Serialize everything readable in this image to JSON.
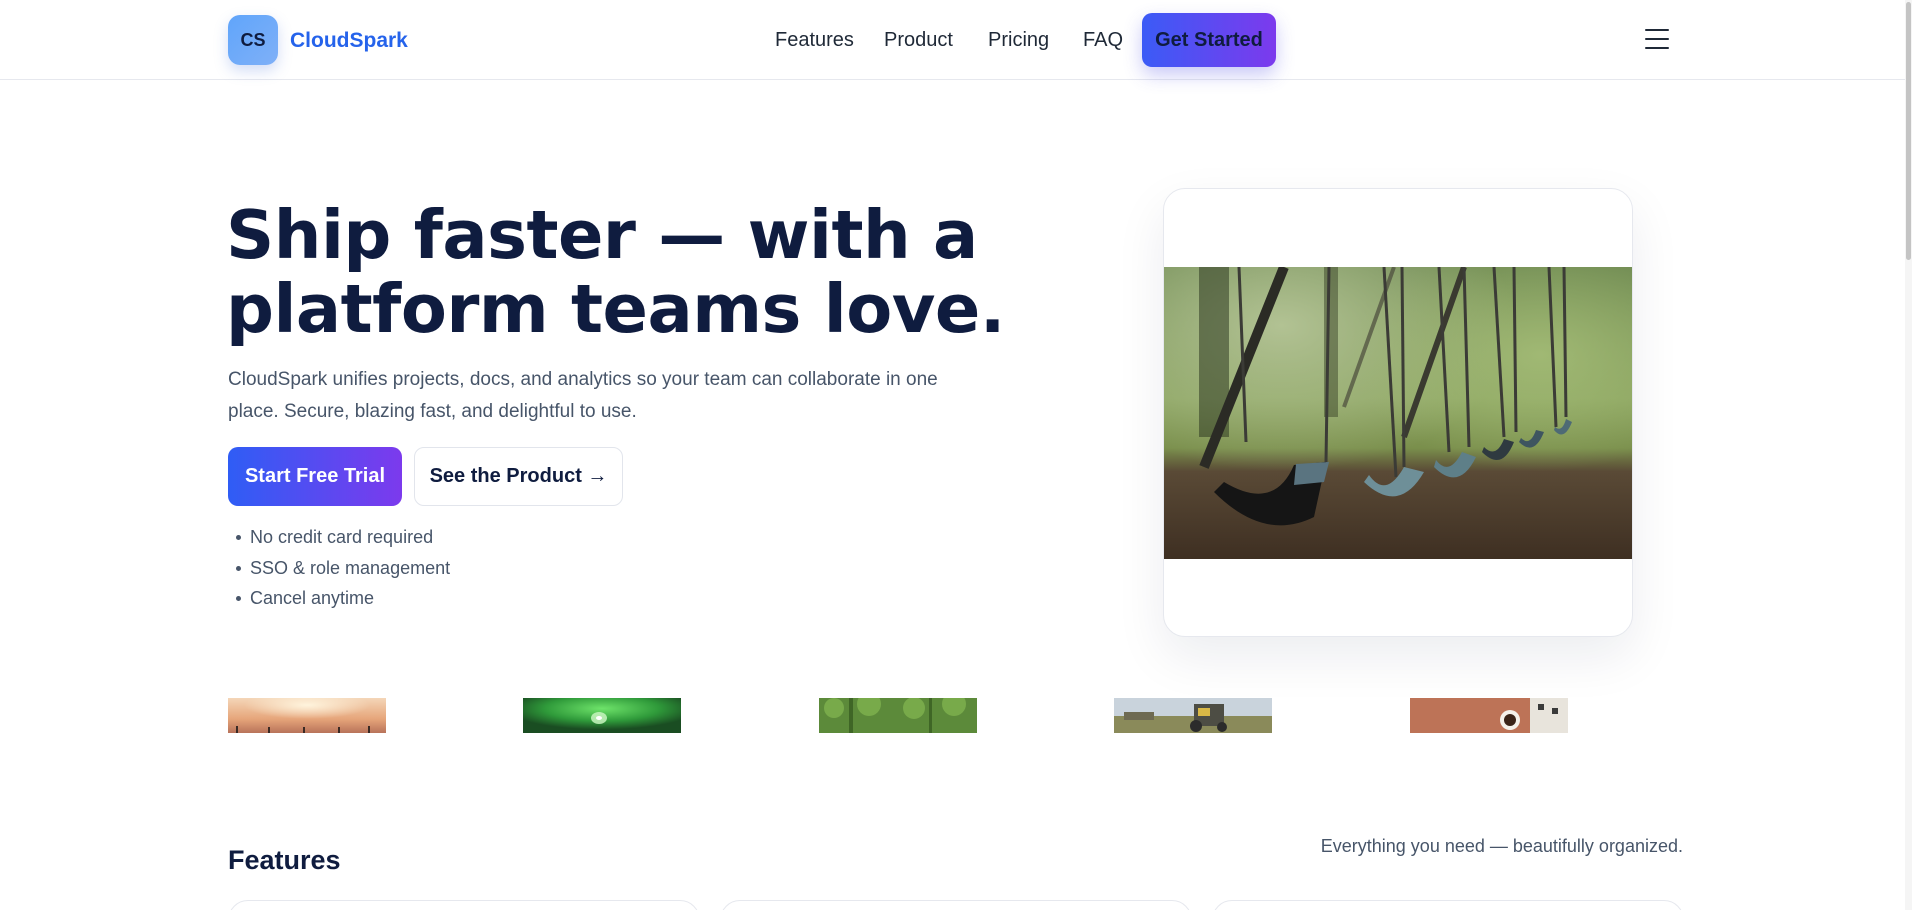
{
  "brand": {
    "badge": "CS",
    "name": "CloudSpark"
  },
  "nav": {
    "items": [
      "Features",
      "Product",
      "Pricing",
      "FAQ"
    ],
    "cta": "Get Started"
  },
  "hero": {
    "title_line1": "Ship faster — with a",
    "title_line2": "platform teams love.",
    "subtitle": "CloudSpark unifies projects, docs, and analytics so your team can collaborate in one place. Secure, blazing fast, and delightful to use.",
    "primary_button": "Start Free Trial",
    "secondary_button": "See the Product →",
    "bullets": [
      "No credit card required",
      "SSO & role management",
      "Cancel anytime"
    ],
    "image_icon": "playground-swings-photo"
  },
  "gallery": {
    "thumbnails": [
      "sunset-photo",
      "green-leaf-droplet-photo",
      "forest-photo",
      "field-tractor-photo",
      "coffee-table-photo"
    ]
  },
  "features": {
    "title": "Features",
    "tagline": "Everything you need — beautifully organized."
  },
  "colors": {
    "accent": "#2563eb",
    "gradient_start": "#3b5bf6",
    "gradient_end": "#7c3aed",
    "heading": "#0f1c3f",
    "body_text": "#475569"
  }
}
